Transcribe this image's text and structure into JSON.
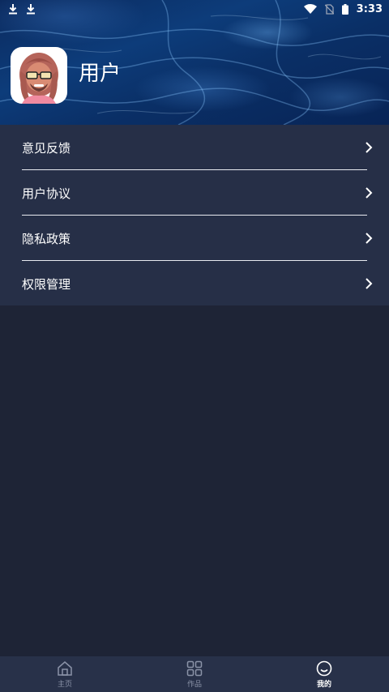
{
  "status_bar": {
    "time": "3:33",
    "left_icons": [
      "download-icon",
      "download-icon"
    ],
    "right_icons": [
      "wifi-icon",
      "no-sim-icon",
      "battery-icon"
    ]
  },
  "profile": {
    "username": "用户",
    "avatar": "avatar-cartoon"
  },
  "menu": {
    "items": [
      {
        "label": "意见反馈",
        "icon": "chevron-right-icon"
      },
      {
        "label": "用户协议",
        "icon": "chevron-right-icon"
      },
      {
        "label": "隐私政策",
        "icon": "chevron-right-icon"
      },
      {
        "label": "权限管理",
        "icon": "chevron-right-icon"
      }
    ]
  },
  "bottom_nav": {
    "items": [
      {
        "label": "主页",
        "icon": "home-icon",
        "active": false
      },
      {
        "label": "作品",
        "icon": "grid-icon",
        "active": false
      },
      {
        "label": "我的",
        "icon": "smile-icon",
        "active": true
      }
    ]
  },
  "colors": {
    "background": "#1e2436",
    "menu_background": "#262f47",
    "nav_background": "#283149",
    "inactive": "#8b93a8",
    "active": "#ffffff"
  }
}
